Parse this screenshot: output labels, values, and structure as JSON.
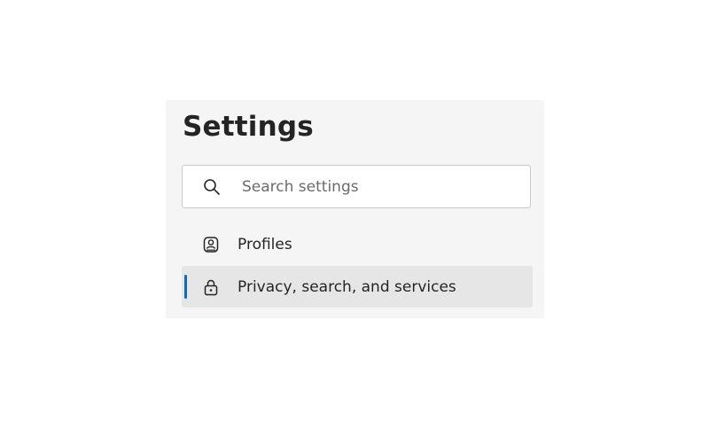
{
  "settings": {
    "title": "Settings",
    "search": {
      "icon": "search-icon",
      "placeholder": "Search settings",
      "value": ""
    },
    "nav": [
      {
        "label": "Profiles",
        "icon": "profiles-icon",
        "selected": false
      },
      {
        "label": "Privacy, search, and services",
        "icon": "lock-icon",
        "selected": true
      }
    ]
  },
  "colors": {
    "panel_background": "#f5f5f5",
    "selected_background": "#e6e6e6",
    "accent": "#0f6cbd"
  }
}
